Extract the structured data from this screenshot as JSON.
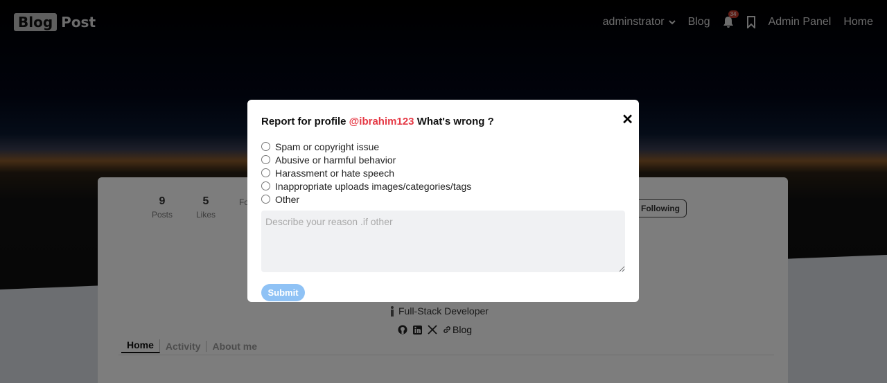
{
  "navbar": {
    "logo_left": "Blog",
    "logo_right": "Post",
    "user_menu": "adminstrator",
    "blog": "Blog",
    "notification_count": "34",
    "admin_panel": "Admin Panel",
    "home": "Home"
  },
  "profile": {
    "stats": [
      {
        "value": "9",
        "label": "Posts"
      },
      {
        "value": "5",
        "label": "Likes"
      },
      {
        "value": "",
        "label": "Fo"
      }
    ],
    "following_label": "Following",
    "job_title": "Full-Stack Developer",
    "blog_link": "Blog",
    "tabs": [
      {
        "label": "Home",
        "active": true
      },
      {
        "label": "Activity",
        "active": false
      },
      {
        "label": "About me",
        "active": false
      }
    ]
  },
  "modal": {
    "title_prefix": "Report for profile",
    "handle": "@ibrahim123",
    "title_suffix": "What's wrong ?",
    "close": "✕",
    "options": [
      "Spam or copyright issue",
      "Abusive or harmful behavior",
      "Harassment or hate speech",
      "Inappropriate uploads images/categories/tags",
      "Other"
    ],
    "reason_placeholder": "Describe your reason .if other",
    "submit_label": "Submit"
  },
  "colors": {
    "handle": "#e53945",
    "submit": "#8fc2f5"
  }
}
